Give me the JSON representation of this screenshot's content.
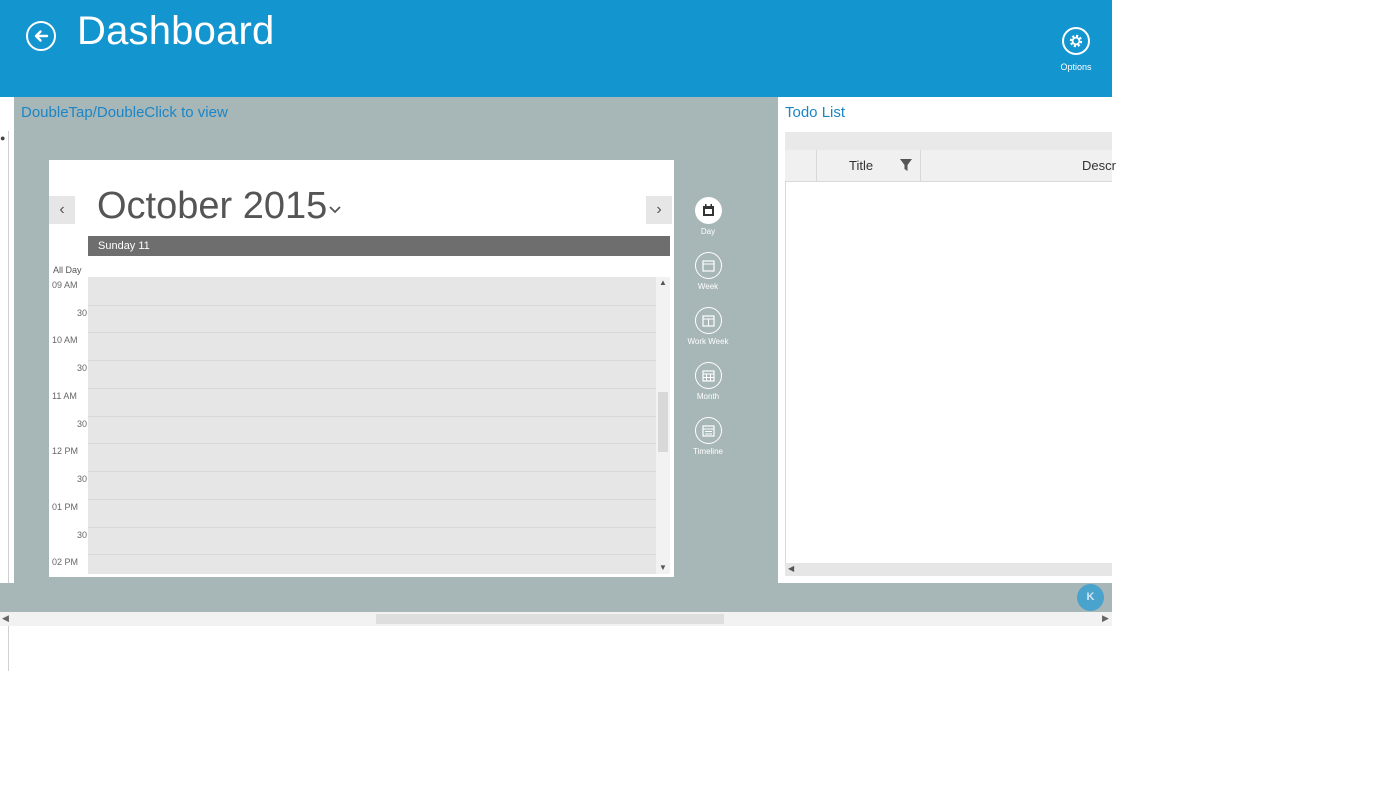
{
  "header": {
    "title": "Dashboard",
    "options_label": "Options",
    "background": "#1395cf"
  },
  "calendar_panel": {
    "hint": "DoubleTap/DoubleClick to view",
    "month_label": "October 2015",
    "day_header": "Sunday 11",
    "all_day_label": "All Day",
    "time_labels": [
      "09 AM",
      "30",
      "10 AM",
      "30",
      "11 AM",
      "30",
      "12 PM",
      "30",
      "01 PM",
      "30",
      "02 PM"
    ],
    "views": [
      {
        "label": "Day",
        "icon": "calendar-day-icon",
        "active": true
      },
      {
        "label": "Week",
        "icon": "calendar-week-icon",
        "active": false
      },
      {
        "label": "Work Week",
        "icon": "calendar-workweek-icon",
        "active": false
      },
      {
        "label": "Month",
        "icon": "calendar-month-icon",
        "active": false
      },
      {
        "label": "Timeline",
        "icon": "calendar-timeline-icon",
        "active": false
      }
    ]
  },
  "todo_panel": {
    "title": "Todo List",
    "columns": [
      "Title",
      "Descr"
    ]
  },
  "floating_button": "K",
  "colors": {
    "accent": "#1395cf",
    "panel_gray": "#a7b6b7",
    "link_blue": "#1b86c6"
  }
}
